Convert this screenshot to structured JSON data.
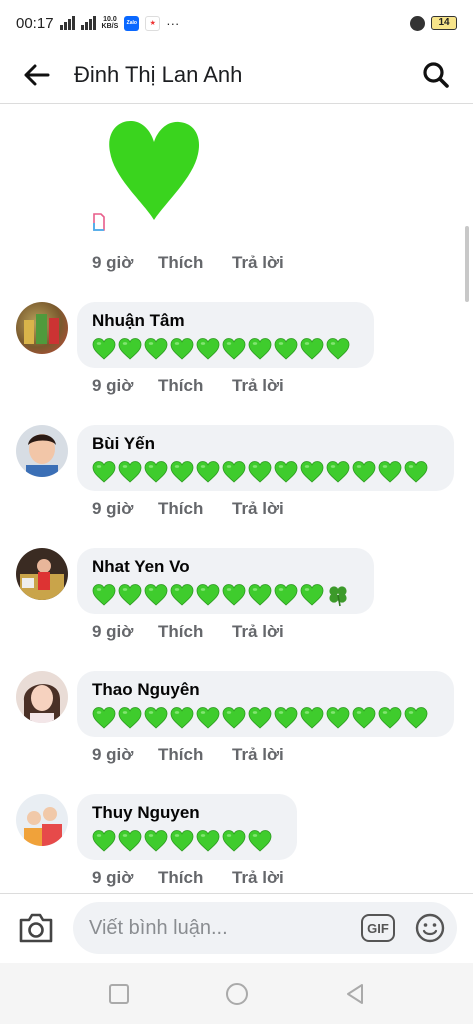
{
  "status_bar": {
    "time": "00:17",
    "speed_value": "10.0",
    "speed_unit": "KB/S",
    "app_zalo_label": "Zalo",
    "more": "···",
    "battery": "14"
  },
  "header": {
    "title": "Đinh Thị Lan Anh"
  },
  "actions": {
    "like": "Thích",
    "reply": "Trả lời"
  },
  "top_comment": {
    "time": "9 giờ"
  },
  "comments": [
    {
      "name": "Nhuận Tâm",
      "time": "9 giờ",
      "hearts": 10,
      "clover": false
    },
    {
      "name": "Bùi Yến",
      "time": "9 giờ",
      "hearts": 13,
      "clover": false
    },
    {
      "name": "Nhat Yen Vo",
      "time": "9 giờ",
      "hearts": 9,
      "clover": true
    },
    {
      "name": "Thao Nguyên",
      "time": "9 giờ",
      "hearts": 13,
      "clover": false
    },
    {
      "name": "Thuy Nguyen",
      "time": "9 giờ",
      "hearts": 7,
      "clover": false
    }
  ],
  "composer": {
    "placeholder": "Viết bình luận...",
    "gif_label": "GIF"
  },
  "colors": {
    "heart_green": "#3fcc2d",
    "sticker_green": "#3ad41e",
    "bubble_bg": "#f0f2f5",
    "meta_gray": "#65676b"
  }
}
